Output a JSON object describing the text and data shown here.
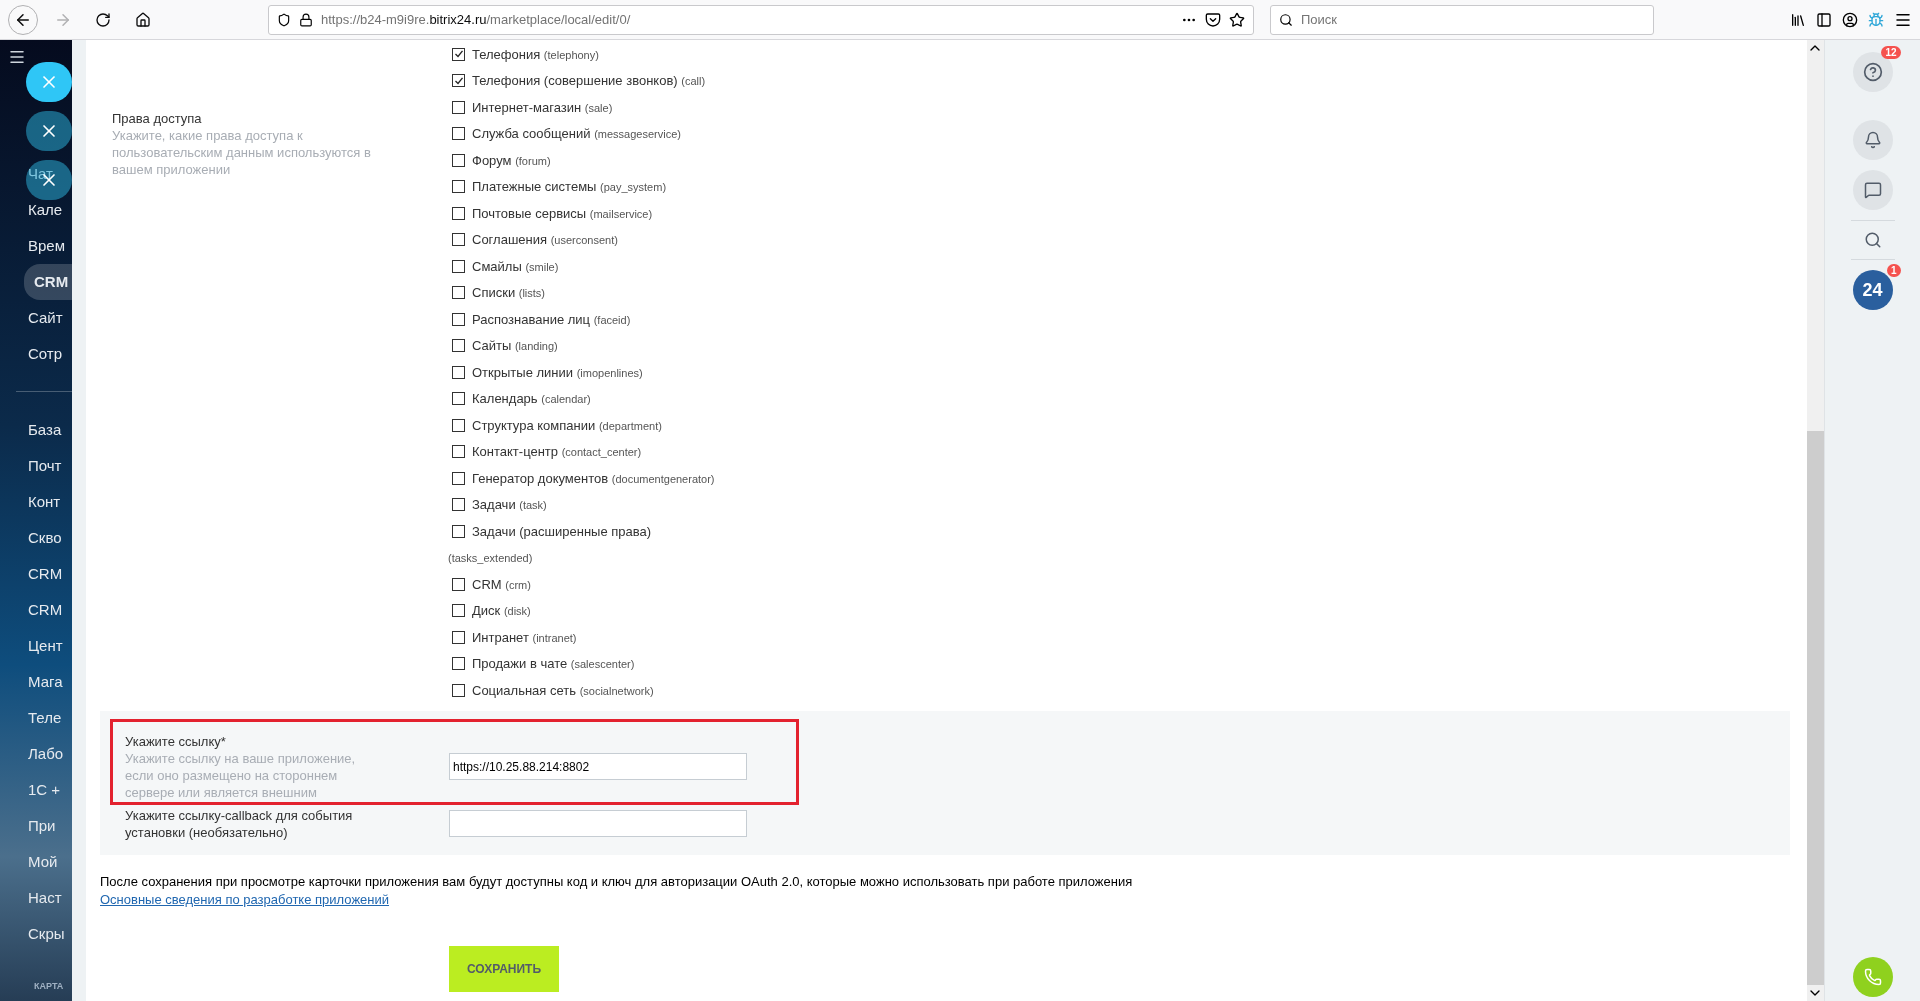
{
  "browser": {
    "url_prefix": "https://b24-m9i9re.",
    "url_domain": "bitrix24.ru",
    "url_path": "/marketplace/local/edit/0/",
    "search_placeholder": "Поиск"
  },
  "sidebar": {
    "top_items": [
      {
        "label": "Чат",
        "selected": false
      },
      {
        "label": "Кале",
        "selected": false
      },
      {
        "label": "Врем",
        "selected": false
      },
      {
        "label": "CRM",
        "selected": true
      },
      {
        "label": "Сайт",
        "selected": false
      },
      {
        "label": "Сотр",
        "selected": false
      }
    ],
    "items": [
      "База",
      "Почт",
      "Конт",
      "Скво",
      "CRM",
      "CRM",
      "Цент",
      "Мага",
      "Теле",
      "Лабо",
      "1С +",
      "При",
      "Мой",
      "Наст",
      "Скры"
    ],
    "footer": "КАРТА"
  },
  "access": {
    "title": "Права доступа",
    "hint": "Укажите, какие права доступа к пользовательским данным используются в вашем приложении",
    "scopes": [
      {
        "label": "Телефония",
        "code": "(telephony)",
        "checked": true,
        "code_on_new_line": false
      },
      {
        "label": "Телефония (совершение звонков)",
        "code": "(call)",
        "checked": true,
        "code_on_new_line": false
      },
      {
        "label": "Интернет-магазин",
        "code": "(sale)",
        "checked": false,
        "code_on_new_line": false
      },
      {
        "label": "Служба сообщений",
        "code": "(messageservice)",
        "checked": false,
        "code_on_new_line": false
      },
      {
        "label": "Форум",
        "code": "(forum)",
        "checked": false,
        "code_on_new_line": false
      },
      {
        "label": "Платежные системы",
        "code": "(pay_system)",
        "checked": false,
        "code_on_new_line": false
      },
      {
        "label": "Почтовые сервисы",
        "code": "(mailservice)",
        "checked": false,
        "code_on_new_line": false
      },
      {
        "label": "Соглашения",
        "code": "(userconsent)",
        "checked": false,
        "code_on_new_line": false
      },
      {
        "label": "Смайлы",
        "code": "(smile)",
        "checked": false,
        "code_on_new_line": false
      },
      {
        "label": "Списки",
        "code": "(lists)",
        "checked": false,
        "code_on_new_line": false
      },
      {
        "label": "Распознавание лиц",
        "code": "(faceid)",
        "checked": false,
        "code_on_new_line": false
      },
      {
        "label": "Сайты",
        "code": "(landing)",
        "checked": false,
        "code_on_new_line": false
      },
      {
        "label": "Открытые линии",
        "code": "(imopenlines)",
        "checked": false,
        "code_on_new_line": false
      },
      {
        "label": "Календарь",
        "code": "(calendar)",
        "checked": false,
        "code_on_new_line": false
      },
      {
        "label": "Структура компании",
        "code": "(department)",
        "checked": false,
        "code_on_new_line": false
      },
      {
        "label": "Контакт-центр",
        "code": "(contact_center)",
        "checked": false,
        "code_on_new_line": false
      },
      {
        "label": "Генератор документов",
        "code": "(documentgenerator)",
        "checked": false,
        "code_on_new_line": false
      },
      {
        "label": "Задачи",
        "code": "(task)",
        "checked": false,
        "code_on_new_line": false
      },
      {
        "label": "Задачи (расширенные права)",
        "code": "(tasks_extended)",
        "checked": false,
        "code_on_new_line": true
      },
      {
        "label": "CRM",
        "code": "(crm)",
        "checked": false,
        "code_on_new_line": false
      },
      {
        "label": "Диск",
        "code": "(disk)",
        "checked": false,
        "code_on_new_line": false
      },
      {
        "label": "Интранет",
        "code": "(intranet)",
        "checked": false,
        "code_on_new_line": false
      },
      {
        "label": "Продажи в чате",
        "code": "(salescenter)",
        "checked": false,
        "code_on_new_line": false
      },
      {
        "label": "Социальная сеть",
        "code": "(socialnetwork)",
        "checked": false,
        "code_on_new_line": false
      }
    ]
  },
  "url_fields": [
    {
      "label": "Укажите ссылку*",
      "hint": "Укажите ссылку на ваше приложение, если оно размещено на стороннем сервере или является внешним",
      "value": "https://10.25.88.214:8802",
      "highlighted": true
    },
    {
      "label": "Укажите ссылку-callback для события установки (необязательно)",
      "highlighted": false
    }
  ],
  "note": "После сохранения при просмотре карточки приложения вам будут доступны код и ключ для авторизации OAuth 2.0, которые можно использовать при работе приложения",
  "link": "Основные сведения по разработке приложений",
  "save_button": "СОХРАНИТЬ",
  "right_panel": {
    "help_badge": "12",
    "bitrix_label": "24",
    "bitrix_badge": "1"
  }
}
